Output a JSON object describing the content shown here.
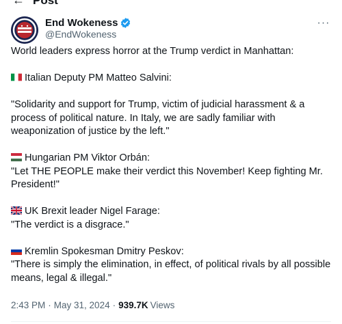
{
  "header": {
    "back_icon": "arrow-left-icon",
    "title": "Post"
  },
  "author": {
    "name": "End Wokeness",
    "handle": "@EndWokeness",
    "verified": true,
    "verified_color": "#1d9bf0"
  },
  "tweet": {
    "intro": "World leaders express horror at the Trump verdict in Manhattan:",
    "quotes": [
      {
        "flag": "italy-flag-icon",
        "speaker": "Italian Deputy PM Matteo Salvini:",
        "text": "\"Solidarity and support for Trump, victim of judicial harassment & a process of political nature. In Italy, we are sadly familiar with weaponization of justice by the left.\""
      },
      {
        "flag": "hungary-flag-icon",
        "speaker": "Hungarian PM Viktor Orbán:",
        "text": "\"Let THE PEOPLE make their verdict this November! Keep fighting Mr. President!\""
      },
      {
        "flag": "uk-flag-icon",
        "speaker": "UK Brexit leader Nigel Farage:",
        "text": "\"The verdict is a disgrace.\""
      },
      {
        "flag": "russia-flag-icon",
        "speaker": "Kremlin Spokesman Dmitry Peskov:",
        "text": "\"There is simply the elimination, in effect, of political rivals by all possible means, legal & illegal.\""
      }
    ]
  },
  "meta": {
    "time": "2:43 PM",
    "separator": "·",
    "date": "May 31, 2024",
    "views_count": "939.7K",
    "views_label": "Views"
  }
}
